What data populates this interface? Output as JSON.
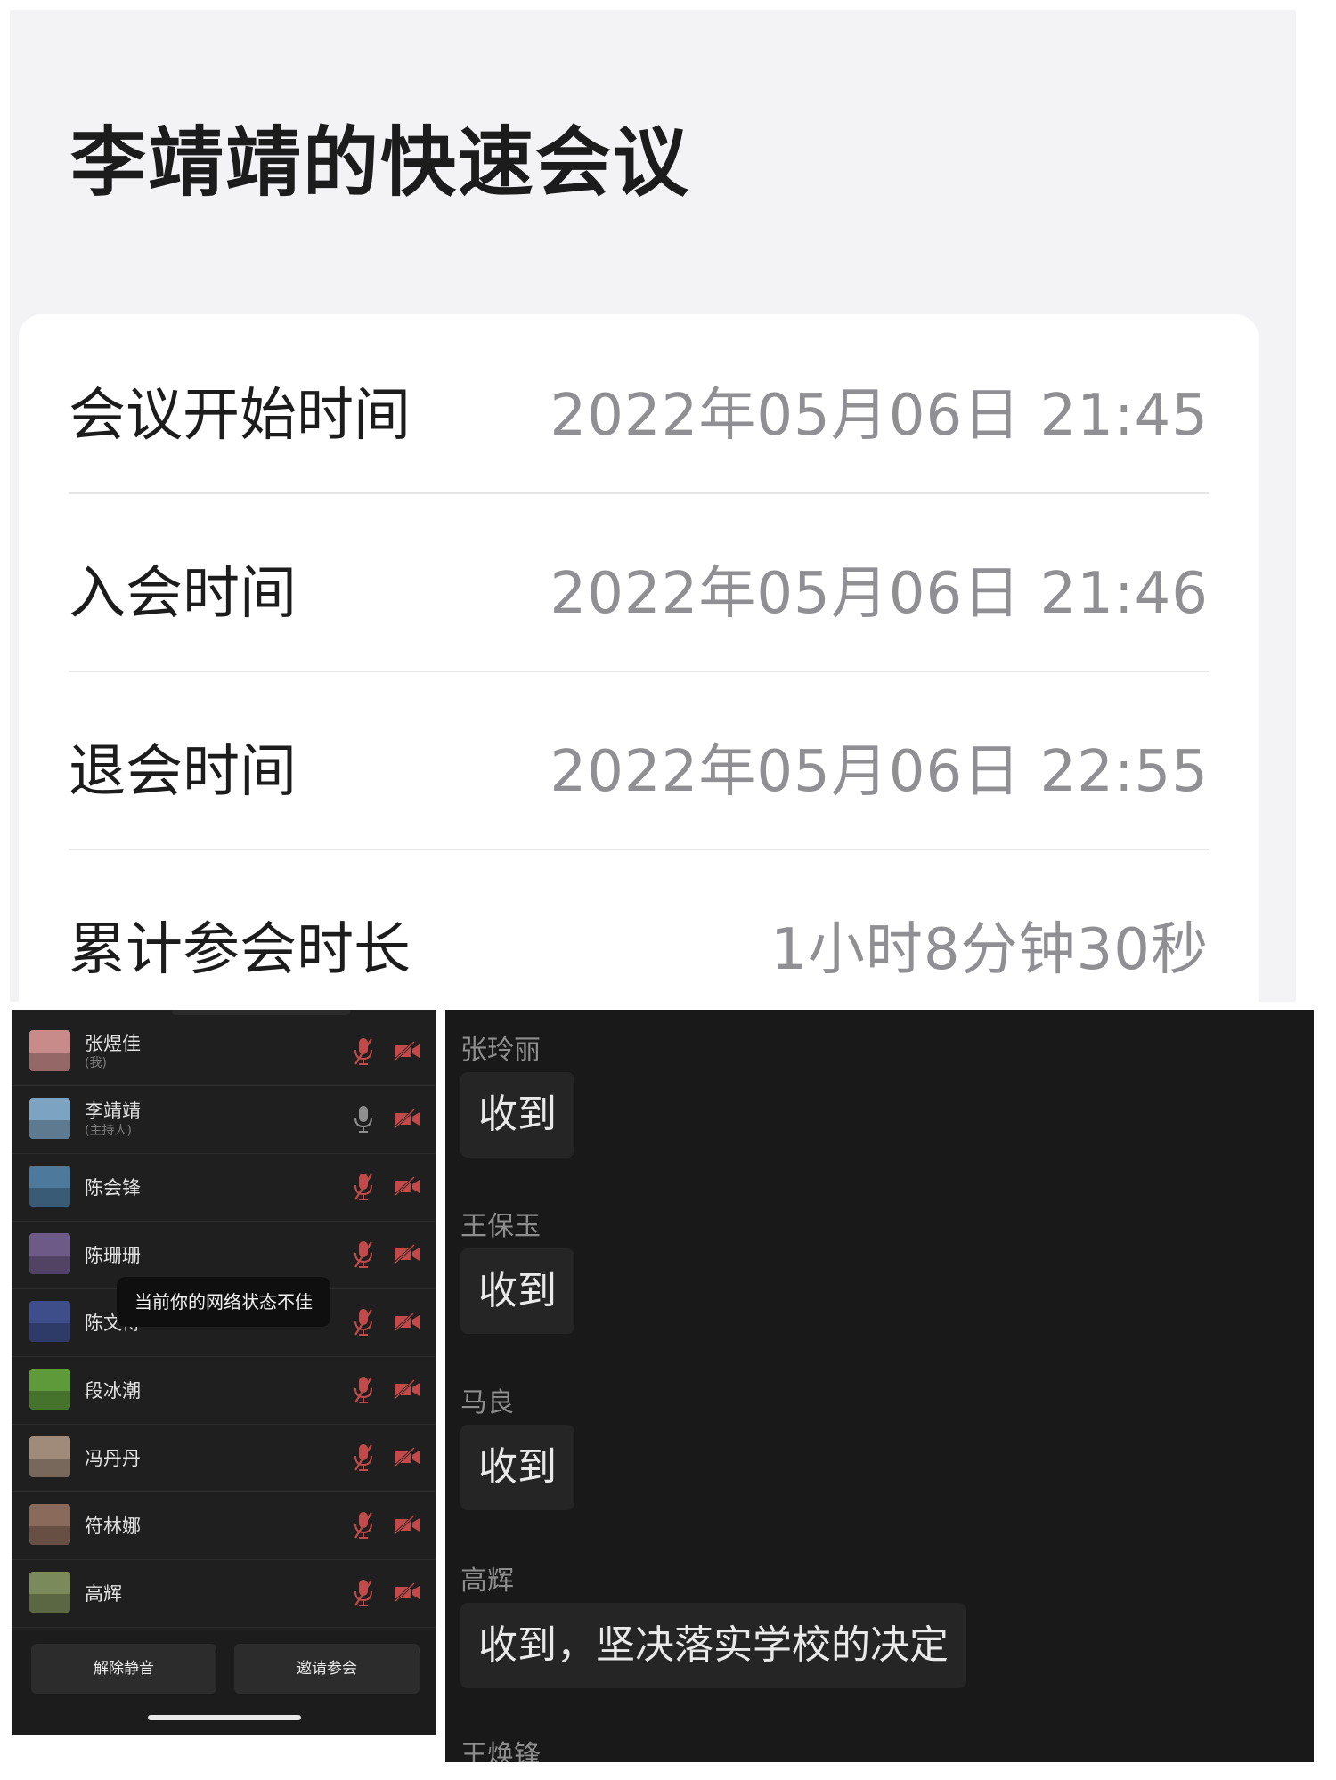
{
  "meeting": {
    "title": "李靖靖的快速会议",
    "rows": [
      {
        "label": "会议开始时间",
        "value": "2022年05月06日 21:45"
      },
      {
        "label": "入会时间",
        "value": "2022年05月06日 21:46"
      },
      {
        "label": "退会时间",
        "value": "2022年05月06日 22:55"
      },
      {
        "label": "累计参会时长",
        "value": "1小时8分钟30秒"
      }
    ]
  },
  "participants": {
    "items": [
      {
        "name": "张煜佳",
        "role": "(我)",
        "mic": "mic-muted-icon",
        "camera": "camera-off-icon",
        "avatar_color": "#c98a8a"
      },
      {
        "name": "李靖靖",
        "role": "(主持人)",
        "mic": "mic-on-icon",
        "camera": "camera-off-icon",
        "avatar_color": "#7da3c2"
      },
      {
        "name": "陈会锋",
        "role": "",
        "mic": "mic-muted-icon",
        "camera": "camera-off-icon",
        "avatar_color": "#4d7a9c"
      },
      {
        "name": "陈珊珊",
        "role": "",
        "mic": "mic-muted-icon",
        "camera": "camera-off-icon",
        "avatar_color": "#6e5a86"
      },
      {
        "name": "陈文博",
        "role": "",
        "mic": "mic-muted-icon",
        "camera": "camera-off-icon",
        "avatar_color": "#3e4e8a"
      },
      {
        "name": "段冰潮",
        "role": "",
        "mic": "mic-muted-icon",
        "camera": "camera-off-icon",
        "avatar_color": "#5e9a3a"
      },
      {
        "name": "冯丹丹",
        "role": "",
        "mic": "mic-muted-icon",
        "camera": "camera-off-icon",
        "avatar_color": "#a08a7a"
      },
      {
        "name": "符林娜",
        "role": "",
        "mic": "mic-muted-icon",
        "camera": "camera-off-icon",
        "avatar_color": "#8a6a5a"
      },
      {
        "name": "高辉",
        "role": "",
        "mic": "mic-muted-icon",
        "camera": "camera-off-icon",
        "avatar_color": "#7a8a5a"
      }
    ],
    "toast": "当前你的网络状态不佳",
    "unmute_label": "解除静音",
    "invite_label": "邀请参会"
  },
  "chat": {
    "messages": [
      {
        "sender": "张玲丽",
        "text": "收到"
      },
      {
        "sender": "王保玉",
        "text": "收到"
      },
      {
        "sender": "马良",
        "text": "收到"
      },
      {
        "sender": "高辉",
        "text": "收到，坚决落实学校的决定"
      }
    ],
    "partial_sender": "王焕锋"
  },
  "colors": {
    "mic_muted": "#c24a4a",
    "mic_on": "#8f8f8f",
    "camera_off": "#c24a4a"
  }
}
